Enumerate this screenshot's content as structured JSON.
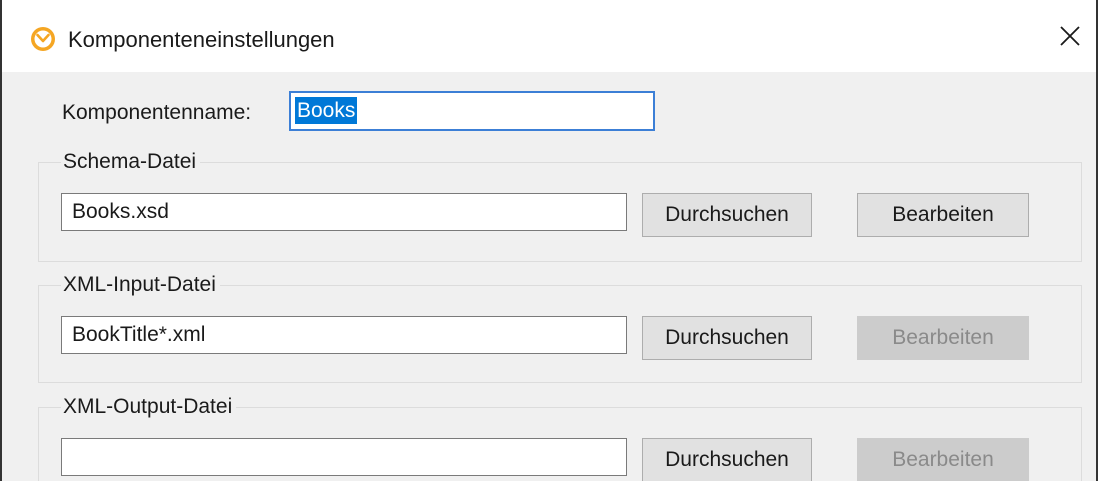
{
  "window": {
    "title": "Komponenteneinstellungen",
    "app_icon": "altova-mapforce-icon",
    "close_icon": "close-icon"
  },
  "component_name": {
    "label": "Komponentenname:",
    "value": "Books"
  },
  "schema_file": {
    "group_label": "Schema-Datei",
    "value": "Books.xsd",
    "browse_label": "Durchsuchen",
    "edit_label": "Bearbeiten",
    "edit_enabled": true
  },
  "xml_input_file": {
    "group_label": "XML-Input-Datei",
    "value": "BookTitle*.xml",
    "browse_label": "Durchsuchen",
    "edit_label": "Bearbeiten",
    "edit_enabled": false
  },
  "xml_output_file": {
    "group_label": "XML-Output-Datei",
    "value": "",
    "browse_label": "Durchsuchen",
    "edit_label": "Bearbeiten",
    "edit_enabled": false
  },
  "colors": {
    "selection": "#0078d7",
    "focus_border": "#3c7fd6",
    "icon_orange": "#f5a623"
  }
}
